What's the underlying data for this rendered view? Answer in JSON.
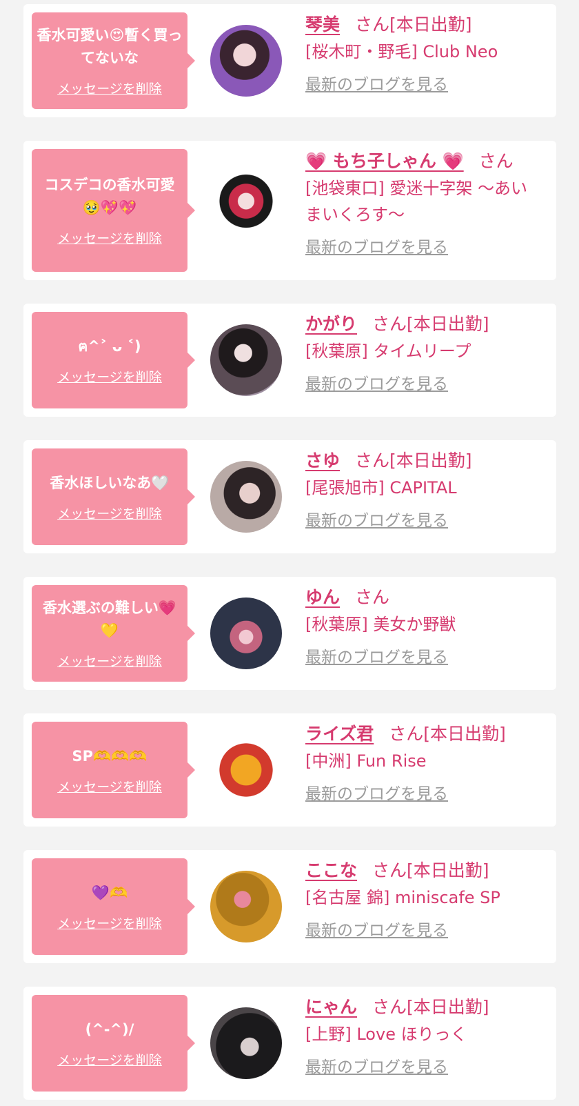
{
  "common": {
    "honorific": "さん",
    "delete_label": "メッセージを削除",
    "blog_label": "最新のブログを見る"
  },
  "items": [
    {
      "message": "香水可愛い😍暫く買ってないな",
      "name": "琴美",
      "status": "[本日出勤]",
      "shop": "[桜木町・野毛] Club Neo"
    },
    {
      "message": "コスデコの香水可愛🥹💖💖",
      "name": "💗 もち子しゃん 💗",
      "status": "",
      "shop": "[池袋東口] 愛迷十字架 〜あいまいくろす〜"
    },
    {
      "message": "ฅ^˃ ᴗ ˂)",
      "name": "かがり",
      "status": "[本日出勤]",
      "shop": "[秋葉原] タイムリープ"
    },
    {
      "message": "香水ほしいなあ🤍",
      "name": "さゆ",
      "status": "[本日出勤]",
      "shop": "[尾張旭市] CAPITAL"
    },
    {
      "message": "香水選ぶの難しい💗💛",
      "name": "ゆん",
      "status": "",
      "shop": "[秋葉原] 美女か野獣"
    },
    {
      "message": "SP🫶🫶🫶",
      "name": "ライズ君",
      "status": "[本日出勤]",
      "shop": "[中洲] Fun Rise"
    },
    {
      "message": "💜🫶",
      "name": "ここな",
      "status": "[本日出勤]",
      "shop": "[名古屋 錦] miniscafe SP"
    },
    {
      "message": "(^-^)/",
      "name": "にゃん",
      "status": "[本日出勤]",
      "shop": "[上野] Love ほりっく"
    }
  ]
}
